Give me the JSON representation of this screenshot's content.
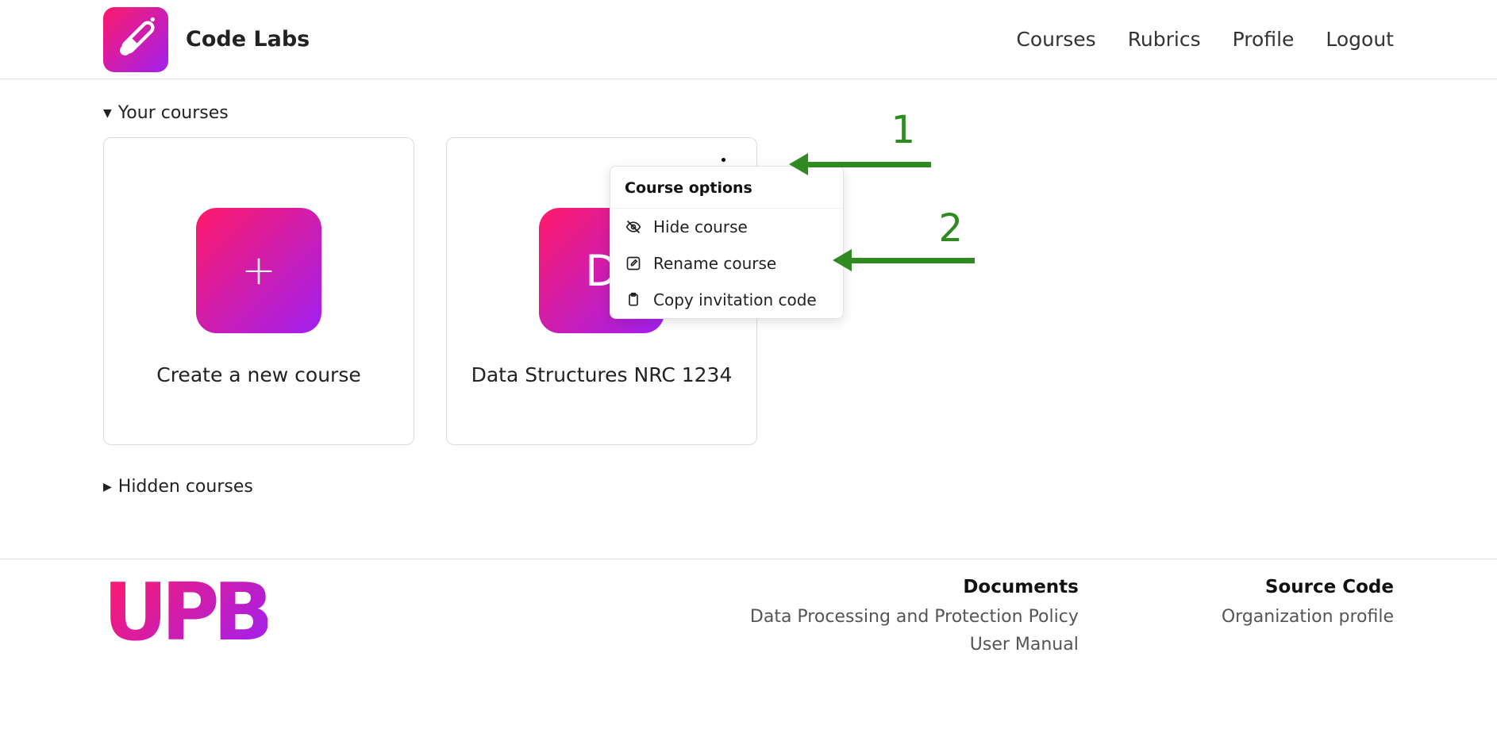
{
  "brand": {
    "name": "Code Labs"
  },
  "nav": {
    "courses": "Courses",
    "rubrics": "Rubrics",
    "profile": "Profile",
    "logout": "Logout"
  },
  "sections": {
    "your": "Your courses",
    "hidden": "Hidden courses"
  },
  "cards": {
    "create": {
      "title": "Create a new course"
    },
    "course0": {
      "letter": "D",
      "title": "Data Structures NRC 1234"
    }
  },
  "menu": {
    "title": "Course options",
    "hide": "Hide course",
    "rename": "Rename course",
    "copy": "Copy invitation code"
  },
  "annotations": {
    "one": "1",
    "two": "2"
  },
  "footer": {
    "documents": {
      "heading": "Documents",
      "link1": "Data Processing and Protection Policy",
      "link2": "User Manual"
    },
    "source": {
      "heading": "Source Code",
      "link1": "Organization profile"
    },
    "logo": "UPB"
  }
}
